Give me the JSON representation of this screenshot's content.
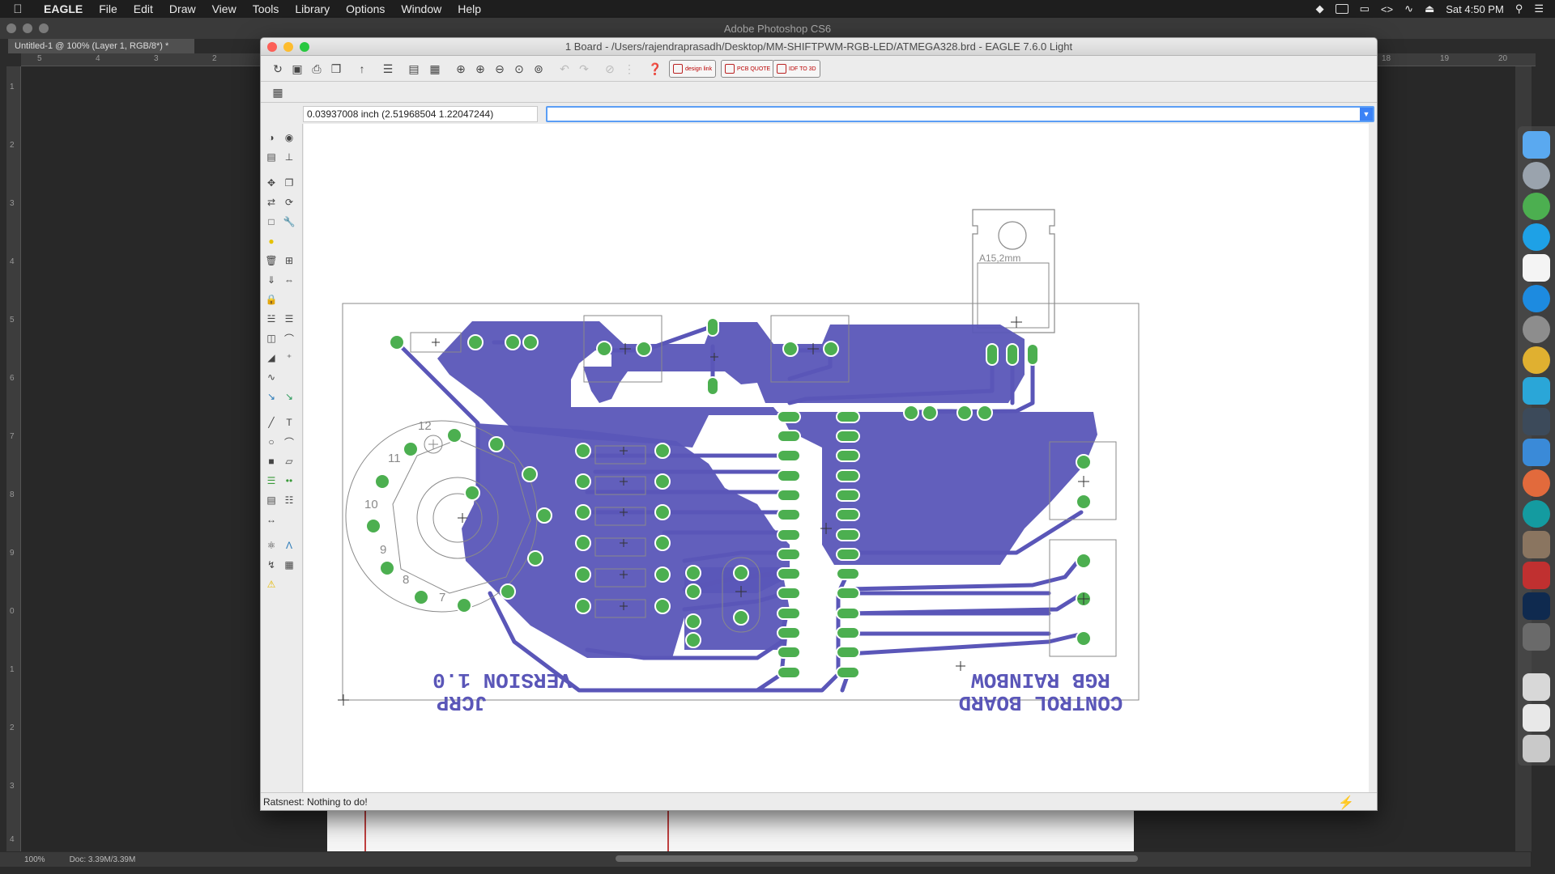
{
  "menubar": {
    "app_name": "EAGLE",
    "items": [
      "File",
      "Edit",
      "Draw",
      "View",
      "Tools",
      "Library",
      "Options",
      "Window",
      "Help"
    ],
    "clock": "Sat 4:50 PM"
  },
  "photoshop": {
    "window_title": "Adobe Photoshop CS6",
    "doc_tab": "Untitled-1 @ 100% (Layer 1, RGB/8*) *",
    "zoom": "100%",
    "doc_size": "Doc: 3.39M/3.39M",
    "ruler_top": [
      "5",
      "4",
      "3",
      "2",
      "18",
      "19",
      "20"
    ],
    "ruler_left": [
      "1",
      "2",
      "3",
      "4",
      "5",
      "6",
      "7",
      "8",
      "9",
      "0",
      "1",
      "2",
      "3",
      "4"
    ]
  },
  "eagle": {
    "title": "1 Board - /Users/rajendraprasadh/Desktop/MM-SHIFTPWM-RGB-LED/ATMEGA328.brd - EAGLE 7.6.0 Light",
    "coordinate": "0.03937008 inch (2.51968504 1.22047244)",
    "command_value": "",
    "status": "Ratsnest: Nothing to do!",
    "buttons": {
      "design_link": "design link",
      "pcb_quote": "PCB QUOTE",
      "idf_to_3d": "IDF TO 3D"
    },
    "board": {
      "regulator_label": "A15,2mm",
      "left_text_line1": "VERSION 1.0",
      "left_text_line2": "JCRP",
      "right_text_line1": "RGB RAINBOW",
      "right_text_line2": "CONTROL BOARD",
      "dial_numbers": [
        "12",
        "11",
        "10",
        "9",
        "8",
        "7"
      ]
    },
    "colors": {
      "copper": "#5a56b8",
      "pad": "#4caf50",
      "outline": "#8a8a8a"
    }
  }
}
